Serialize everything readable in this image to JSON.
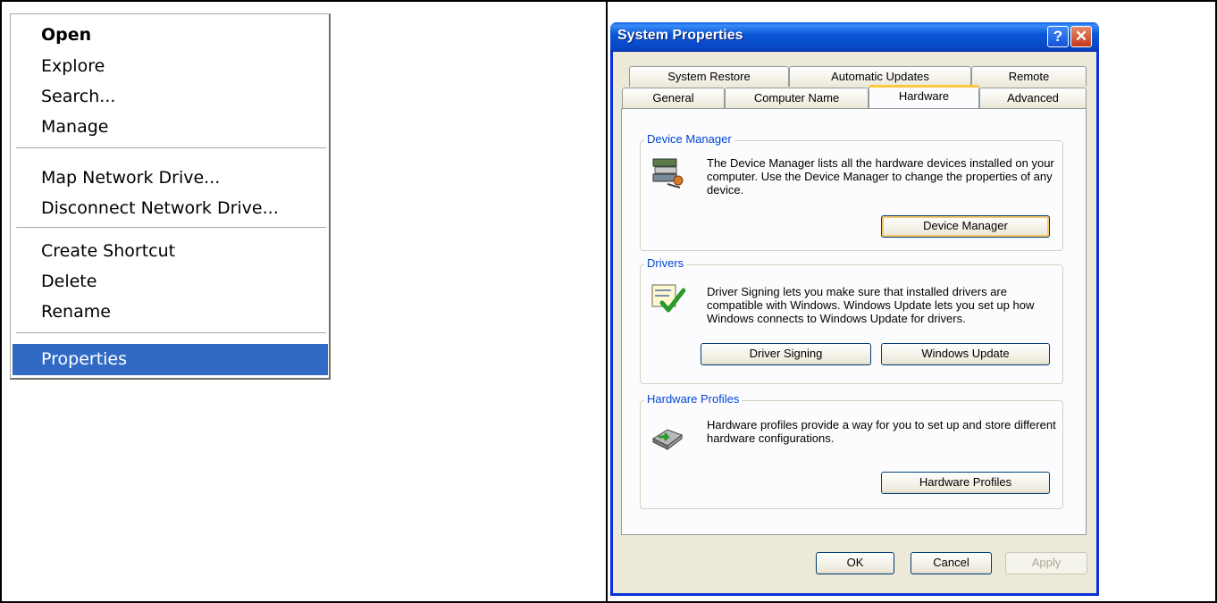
{
  "context_menu": {
    "items": [
      {
        "label": "Open"
      },
      {
        "label": "Explore"
      },
      {
        "label": "Search..."
      },
      {
        "label": "Manage"
      },
      {
        "label": "Map Network Drive..."
      },
      {
        "label": "Disconnect Network Drive..."
      },
      {
        "label": "Create Shortcut"
      },
      {
        "label": "Delete"
      },
      {
        "label": "Rename"
      },
      {
        "label": "Properties"
      }
    ],
    "selected": "Properties"
  },
  "dialog": {
    "title": "System Properties",
    "help_label": "?",
    "close_label": "✕",
    "tabs_row1": [
      "System Restore",
      "Automatic Updates",
      "Remote"
    ],
    "tabs_row2": [
      "General",
      "Computer Name",
      "Hardware",
      "Advanced"
    ],
    "active_tab": "Hardware",
    "groups": {
      "device_manager": {
        "label": "Device Manager",
        "text": "The Device Manager lists all the hardware devices installed on your computer. Use the Device Manager to change the properties of any device.",
        "button": "Device Manager"
      },
      "drivers": {
        "label": "Drivers",
        "text": "Driver Signing lets you make sure that installed drivers are compatible with Windows. Windows Update lets you set up how Windows connects to Windows Update for drivers.",
        "button_signing": "Driver Signing",
        "button_update": "Windows Update"
      },
      "hardware_profiles": {
        "label": "Hardware Profiles",
        "text": "Hardware profiles provide a way for you to set up and store different hardware configurations.",
        "button": "Hardware Profiles"
      }
    },
    "footer": {
      "ok": "OK",
      "cancel": "Cancel",
      "apply": "Apply"
    }
  },
  "colors": {
    "menu_highlight": "#316ac5",
    "titlebar": "#0a58d6",
    "dialog_bg": "#ece9d8",
    "group_label": "#0046d5",
    "focus_ring": "#f5c96a"
  }
}
